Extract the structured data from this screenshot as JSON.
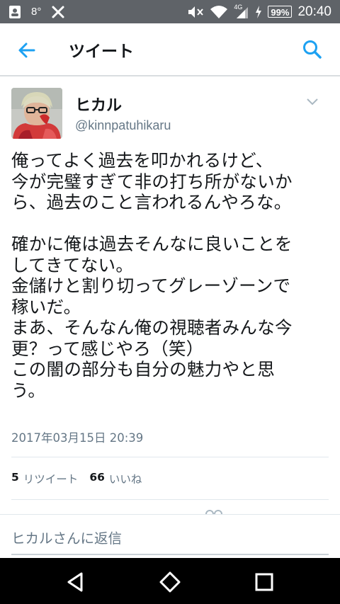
{
  "status_bar": {
    "temperature": "8°",
    "battery": "99%",
    "network": "4G",
    "time": "20:40"
  },
  "app_bar": {
    "title": "ツイート"
  },
  "tweet": {
    "author_name": "ヒカル",
    "author_handle": "@kinnpatuhikaru",
    "text": "俺ってよく過去を叩かれるけど、\n今が完璧すぎて非の打ち所がないか\nら、過去のこと言われるんやろな。\n\n確かに俺は過去そんなに良いことを\nしてきてない。\n金儲けと割り切ってグレーゾーンで\n稼いだ。\nまあ、そんなん俺の視聴者みんな今\n更？って感じやろ（笑）\nこの闇の部分も自分の魅力やと思\nう。",
    "timestamp": "2017年03月15日 20:39",
    "retweet_count": "5",
    "retweet_label": "リツイート",
    "like_count": "66",
    "like_label": "いいね"
  },
  "reply": {
    "placeholder": "ヒカルさんに返信"
  },
  "icons": {
    "back": "back-arrow-icon",
    "search": "search-icon",
    "caret": "chevron-down-icon",
    "nav_back": "nav-back-icon",
    "nav_home": "nav-home-icon",
    "nav_recents": "nav-recents-icon"
  },
  "colors": {
    "accent": "#1da1f2",
    "status_bar": "#5f6368",
    "secondary_text": "#657786"
  }
}
